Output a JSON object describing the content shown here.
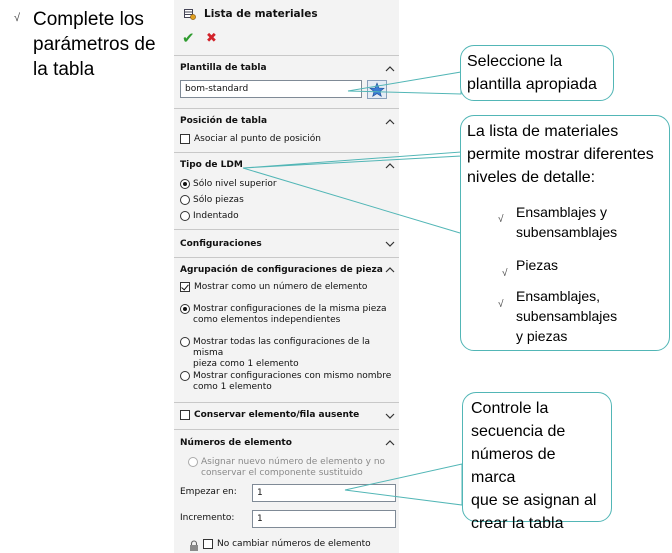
{
  "slide": {
    "bullet": "√",
    "intro_lines": [
      "Complete los",
      "parámetros de",
      "la tabla"
    ]
  },
  "panel": {
    "title": "Lista de materiales",
    "ok": "✔",
    "cancel": "✖",
    "template_section": {
      "title": "Plantilla de tabla",
      "value": "bom-standard"
    },
    "position_section": {
      "title": "Posición de tabla",
      "checkbox_label": "Asociar al punto de posición",
      "checked": false
    },
    "type_section": {
      "title": "Tipo de LDM",
      "options": [
        "Sólo nivel superior",
        "Sólo piezas",
        "Indentado"
      ],
      "selected": 0
    },
    "configurations_section": {
      "title": "Configuraciones"
    },
    "grouping_section": {
      "title": "Agrupación de configuraciones de pieza",
      "checkbox_label": "Mostrar como un número de elemento",
      "checkbox_checked": true,
      "options": [
        [
          "Mostrar configuraciones de la misma pieza",
          "como elementos independientes"
        ],
        [
          "Mostrar todas las configuraciones de la misma",
          "pieza como 1 elemento"
        ],
        [
          "Mostrar configuraciones con mismo nombre",
          "como 1 elemento"
        ]
      ],
      "selected": 0
    },
    "keep_section": {
      "title": "Conservar elemento/fila ausente",
      "checked": false
    },
    "item_numbers_section": {
      "title": "Números de elemento",
      "disabled_option": [
        "Asignar nuevo número de elemento y no",
        "conservar el componente sustituido"
      ],
      "start_label": "Empezar en:",
      "start_value": "1",
      "increment_label": "Incremento:",
      "increment_value": "1",
      "no_change_label": "No cambiar números de elemento"
    }
  },
  "callouts": {
    "template": [
      "Seleccione la",
      "plantilla apropiada"
    ],
    "ldm": [
      "La lista de materiales",
      "permite mostrar diferentes",
      "niveles de detalle:"
    ],
    "ldm_items": [
      [
        "Ensamblajes y",
        "subensamblajes"
      ],
      [
        "Piezas"
      ],
      [
        "Ensamblajes,",
        "subensamblajes",
        "y piezas"
      ]
    ],
    "numbers": [
      "Controle la",
      "secuencia de",
      "números de marca",
      "que se asignan al",
      "crear la tabla"
    ]
  },
  "colors": {
    "callout_border": "#52b6b6",
    "ok": "#2e9b2e",
    "cancel": "#d2232a",
    "panel_bg": "#f3f3f3"
  }
}
